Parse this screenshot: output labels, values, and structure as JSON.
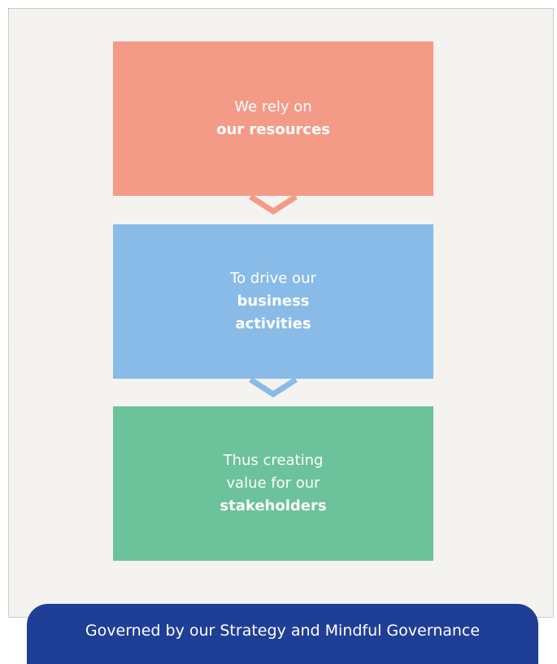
{
  "boxes": [
    {
      "lines": [
        {
          "text": "We rely on",
          "bold": false
        },
        {
          "text": "our resources",
          "bold": true
        }
      ]
    },
    {
      "lines": [
        {
          "text": "To drive our",
          "bold": false
        },
        {
          "text": "business",
          "bold": true
        },
        {
          "text": "activities",
          "bold": true
        }
      ]
    },
    {
      "lines": [
        {
          "text": "Thus creating",
          "bold": false
        },
        {
          "text": "value for our",
          "bold": false
        },
        {
          "text": "stakeholders",
          "bold": true
        }
      ]
    }
  ],
  "governance": {
    "text": "Governed by our Strategy and Mindful Governance"
  },
  "colors": {
    "resources": "#f49b88",
    "activities": "#89bbe8",
    "stakeholders": "#6cc29a",
    "governance": "#1f3f96",
    "background": "#f5f3ef"
  }
}
